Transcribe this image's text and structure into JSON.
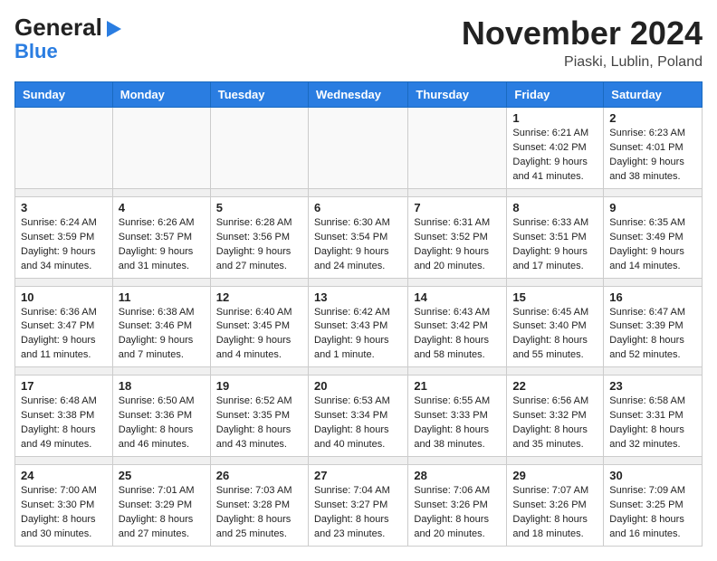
{
  "logo": {
    "line1": "General",
    "line2": "Blue"
  },
  "header": {
    "month": "November 2024",
    "location": "Piaski, Lublin, Poland"
  },
  "weekdays": [
    "Sunday",
    "Monday",
    "Tuesday",
    "Wednesday",
    "Thursday",
    "Friday",
    "Saturday"
  ],
  "weeks": [
    [
      {
        "day": "",
        "info": ""
      },
      {
        "day": "",
        "info": ""
      },
      {
        "day": "",
        "info": ""
      },
      {
        "day": "",
        "info": ""
      },
      {
        "day": "",
        "info": ""
      },
      {
        "day": "1",
        "info": "Sunrise: 6:21 AM\nSunset: 4:02 PM\nDaylight: 9 hours\nand 41 minutes."
      },
      {
        "day": "2",
        "info": "Sunrise: 6:23 AM\nSunset: 4:01 PM\nDaylight: 9 hours\nand 38 minutes."
      }
    ],
    [
      {
        "day": "3",
        "info": "Sunrise: 6:24 AM\nSunset: 3:59 PM\nDaylight: 9 hours\nand 34 minutes."
      },
      {
        "day": "4",
        "info": "Sunrise: 6:26 AM\nSunset: 3:57 PM\nDaylight: 9 hours\nand 31 minutes."
      },
      {
        "day": "5",
        "info": "Sunrise: 6:28 AM\nSunset: 3:56 PM\nDaylight: 9 hours\nand 27 minutes."
      },
      {
        "day": "6",
        "info": "Sunrise: 6:30 AM\nSunset: 3:54 PM\nDaylight: 9 hours\nand 24 minutes."
      },
      {
        "day": "7",
        "info": "Sunrise: 6:31 AM\nSunset: 3:52 PM\nDaylight: 9 hours\nand 20 minutes."
      },
      {
        "day": "8",
        "info": "Sunrise: 6:33 AM\nSunset: 3:51 PM\nDaylight: 9 hours\nand 17 minutes."
      },
      {
        "day": "9",
        "info": "Sunrise: 6:35 AM\nSunset: 3:49 PM\nDaylight: 9 hours\nand 14 minutes."
      }
    ],
    [
      {
        "day": "10",
        "info": "Sunrise: 6:36 AM\nSunset: 3:47 PM\nDaylight: 9 hours\nand 11 minutes."
      },
      {
        "day": "11",
        "info": "Sunrise: 6:38 AM\nSunset: 3:46 PM\nDaylight: 9 hours\nand 7 minutes."
      },
      {
        "day": "12",
        "info": "Sunrise: 6:40 AM\nSunset: 3:45 PM\nDaylight: 9 hours\nand 4 minutes."
      },
      {
        "day": "13",
        "info": "Sunrise: 6:42 AM\nSunset: 3:43 PM\nDaylight: 9 hours\nand 1 minute."
      },
      {
        "day": "14",
        "info": "Sunrise: 6:43 AM\nSunset: 3:42 PM\nDaylight: 8 hours\nand 58 minutes."
      },
      {
        "day": "15",
        "info": "Sunrise: 6:45 AM\nSunset: 3:40 PM\nDaylight: 8 hours\nand 55 minutes."
      },
      {
        "day": "16",
        "info": "Sunrise: 6:47 AM\nSunset: 3:39 PM\nDaylight: 8 hours\nand 52 minutes."
      }
    ],
    [
      {
        "day": "17",
        "info": "Sunrise: 6:48 AM\nSunset: 3:38 PM\nDaylight: 8 hours\nand 49 minutes."
      },
      {
        "day": "18",
        "info": "Sunrise: 6:50 AM\nSunset: 3:36 PM\nDaylight: 8 hours\nand 46 minutes."
      },
      {
        "day": "19",
        "info": "Sunrise: 6:52 AM\nSunset: 3:35 PM\nDaylight: 8 hours\nand 43 minutes."
      },
      {
        "day": "20",
        "info": "Sunrise: 6:53 AM\nSunset: 3:34 PM\nDaylight: 8 hours\nand 40 minutes."
      },
      {
        "day": "21",
        "info": "Sunrise: 6:55 AM\nSunset: 3:33 PM\nDaylight: 8 hours\nand 38 minutes."
      },
      {
        "day": "22",
        "info": "Sunrise: 6:56 AM\nSunset: 3:32 PM\nDaylight: 8 hours\nand 35 minutes."
      },
      {
        "day": "23",
        "info": "Sunrise: 6:58 AM\nSunset: 3:31 PM\nDaylight: 8 hours\nand 32 minutes."
      }
    ],
    [
      {
        "day": "24",
        "info": "Sunrise: 7:00 AM\nSunset: 3:30 PM\nDaylight: 8 hours\nand 30 minutes."
      },
      {
        "day": "25",
        "info": "Sunrise: 7:01 AM\nSunset: 3:29 PM\nDaylight: 8 hours\nand 27 minutes."
      },
      {
        "day": "26",
        "info": "Sunrise: 7:03 AM\nSunset: 3:28 PM\nDaylight: 8 hours\nand 25 minutes."
      },
      {
        "day": "27",
        "info": "Sunrise: 7:04 AM\nSunset: 3:27 PM\nDaylight: 8 hours\nand 23 minutes."
      },
      {
        "day": "28",
        "info": "Sunrise: 7:06 AM\nSunset: 3:26 PM\nDaylight: 8 hours\nand 20 minutes."
      },
      {
        "day": "29",
        "info": "Sunrise: 7:07 AM\nSunset: 3:26 PM\nDaylight: 8 hours\nand 18 minutes."
      },
      {
        "day": "30",
        "info": "Sunrise: 7:09 AM\nSunset: 3:25 PM\nDaylight: 8 hours\nand 16 minutes."
      }
    ]
  ]
}
